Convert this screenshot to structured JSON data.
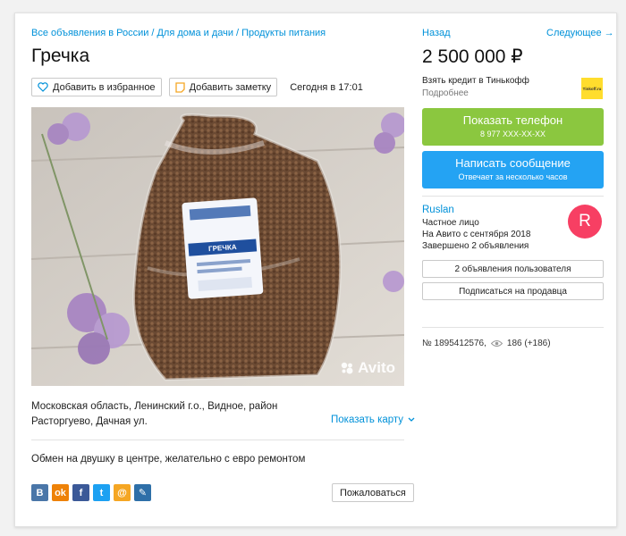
{
  "breadcrumbs": [
    "Все объявления в России",
    "Для дома и дачи",
    "Продукты питания"
  ],
  "breadcrumb_sep": "/",
  "title": "Гречка",
  "actions": {
    "favorite_label": "Добавить в избранное",
    "note_label": "Добавить заметку",
    "date": "Сегодня в 17:01"
  },
  "photo": {
    "label_text": "ГРЕЧКА",
    "watermark": "Avito"
  },
  "address": "Московская область, Ленинский г.о., Видное, район Расторгуево, Дачная ул.",
  "show_map_label": "Показать карту",
  "description": "Обмен на двушку в центре, желательно с евро ремонтом",
  "social": [
    {
      "icon": "vk-icon",
      "glyph": "B",
      "color": "#4a76a8"
    },
    {
      "icon": "odnoklassniki-icon",
      "glyph": "ok",
      "color": "#ee8208"
    },
    {
      "icon": "facebook-icon",
      "glyph": "f",
      "color": "#3b5998"
    },
    {
      "icon": "twitter-icon",
      "glyph": "t",
      "color": "#1da1f2"
    },
    {
      "icon": "mail-icon",
      "glyph": "@",
      "color": "#f5a623"
    },
    {
      "icon": "livejournal-icon",
      "glyph": "✎",
      "color": "#2e6fa8"
    }
  ],
  "complain_label": "Пожаловаться",
  "nav": {
    "back_label": "Назад",
    "next_label": "Следующее →"
  },
  "price": "2 500 000 ₽",
  "credit": {
    "text": "Взять кредит в Тинькофф",
    "more": "Подробнее",
    "logo_text": "Tinkoff.ru"
  },
  "show_phone": {
    "label": "Показать телефон",
    "sub": "8 977 XXX-XX-XX"
  },
  "write_message": {
    "label": "Написать сообщение",
    "sub": "Отвечает за несколько часов"
  },
  "seller": {
    "name": "Ruslan",
    "type": "Частное лицо",
    "since": "На Авито с сентября 2018",
    "completed": "Завершено 2 объявления",
    "avatar_letter": "R",
    "avatar_color": "#f73f63",
    "ads_button": "2 объявления пользователя",
    "subscribe_button": "Подписаться на продавца"
  },
  "listing": {
    "number": "№ 1895412576,",
    "views": "186 (+186)"
  },
  "colors": {
    "link": "#0091d9",
    "green": "#8bc73f",
    "blue": "#24a3f3"
  }
}
